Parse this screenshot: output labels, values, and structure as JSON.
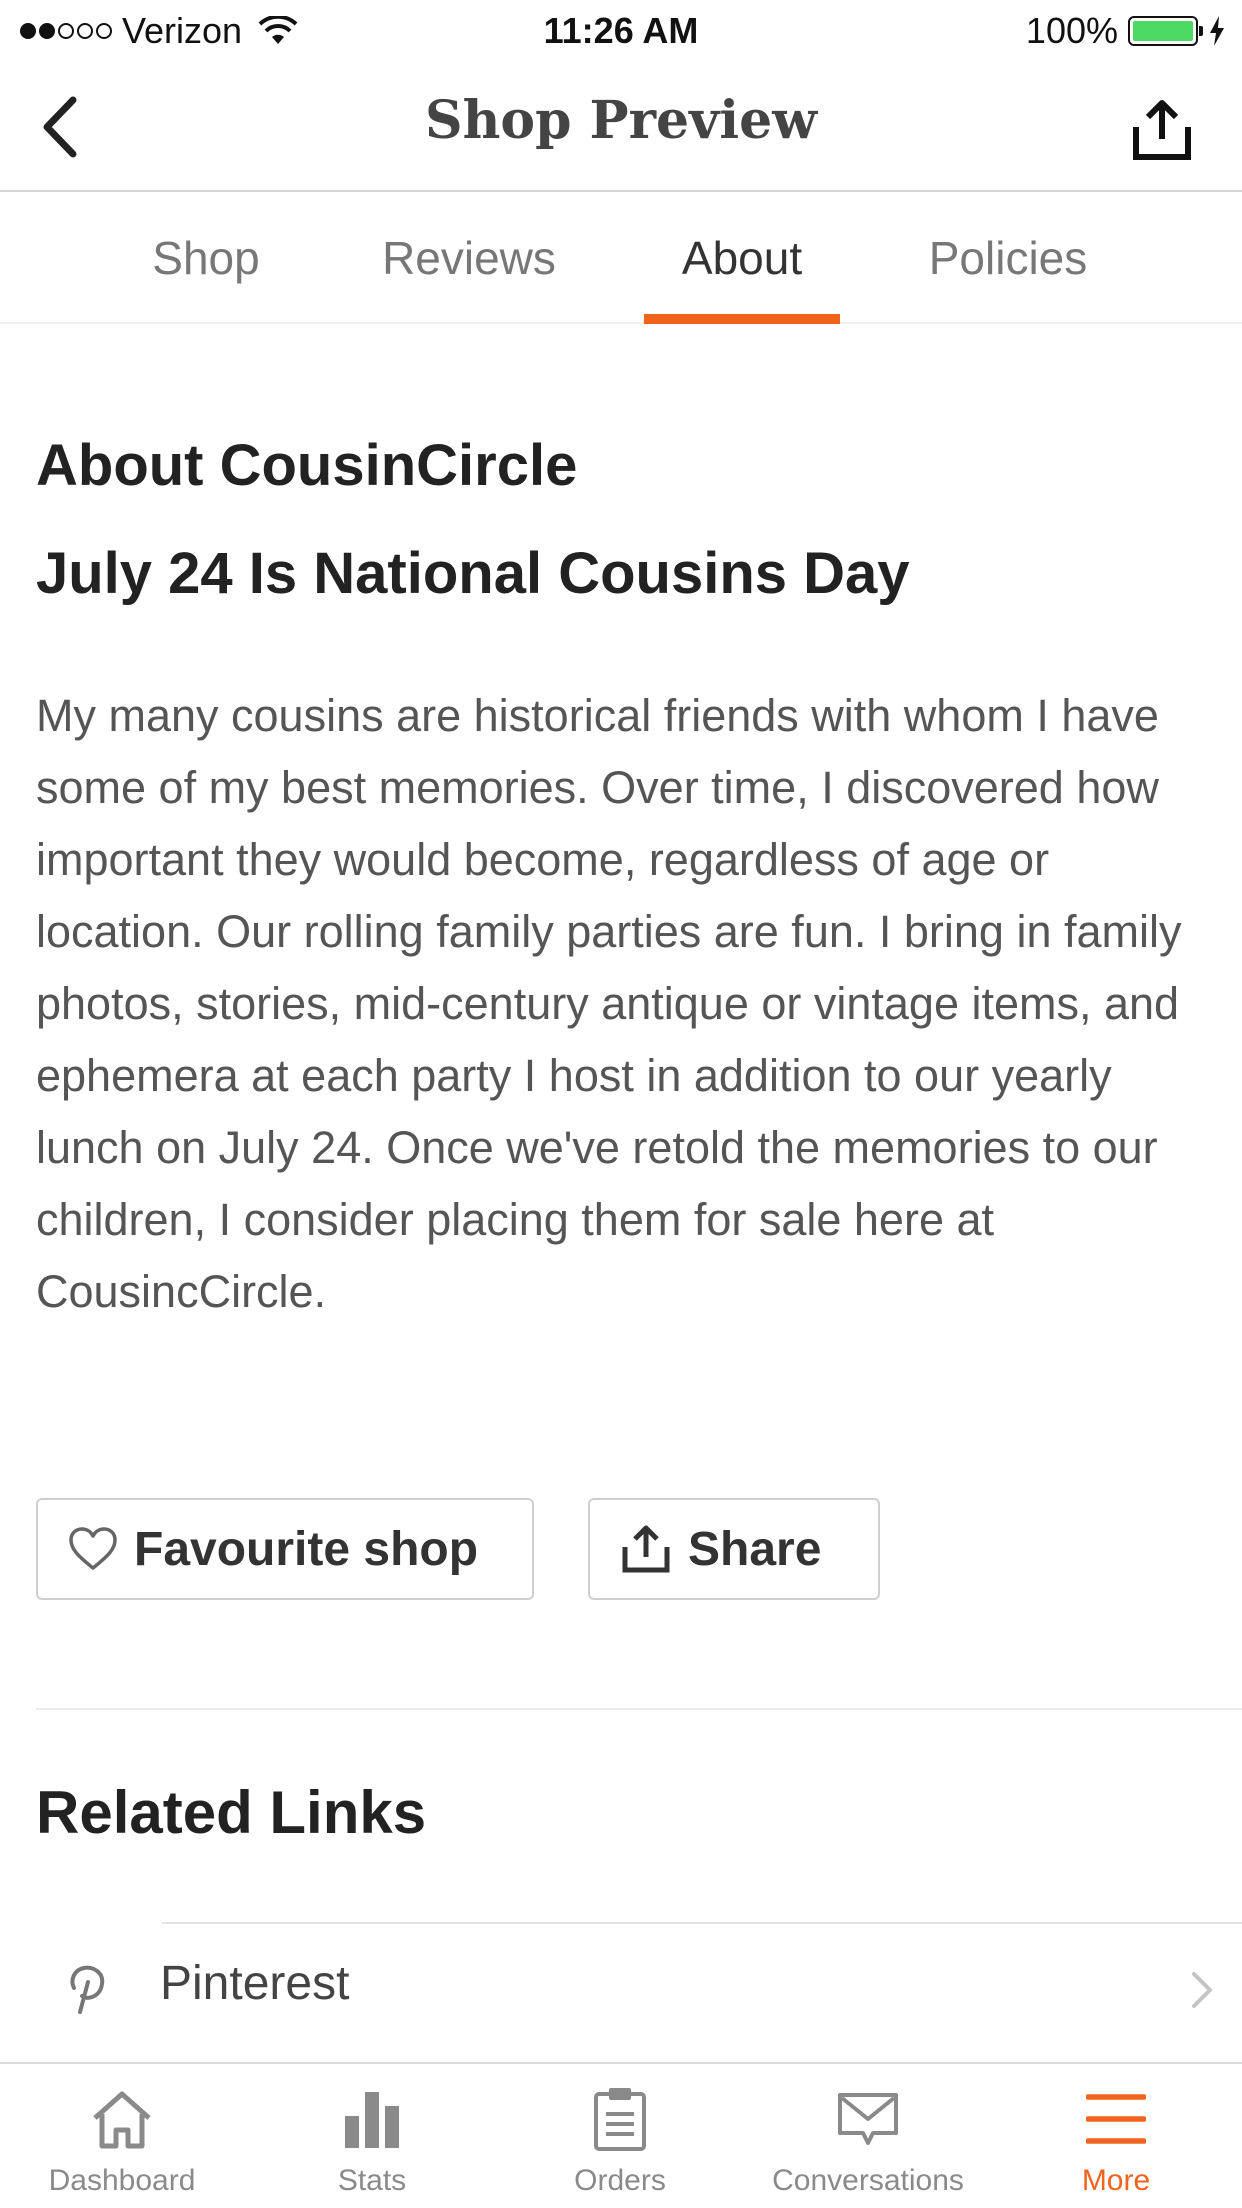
{
  "status_bar": {
    "carrier": "Verizon",
    "time": "11:26 AM",
    "battery": "100%"
  },
  "nav": {
    "title": "Shop Preview",
    "back_icon": "chevron-left-icon",
    "share_icon": "share-icon"
  },
  "tabs": [
    {
      "label": "Shop",
      "active": false
    },
    {
      "label": "Reviews",
      "active": false
    },
    {
      "label": "About",
      "active": true
    },
    {
      "label": "Policies",
      "active": false
    }
  ],
  "about": {
    "title": "About CousinCircle",
    "headline": "July 24 Is National Cousins Day",
    "story": "My many cousins are historical friends with whom I have some of my best memories. Over time, I discovered how important they would become, regardless of age or location. Our rolling family parties are fun. I bring in family photos, stories, mid-century antique or vintage items, and ephemera at each party I host in addition to our yearly lunch on July 24. Once we've retold the memories to our children, I consider placing them for sale here at CousincCircle."
  },
  "actions": {
    "favourite_label": "Favourite shop",
    "share_label": "Share"
  },
  "related": {
    "title": "Related Links",
    "links": [
      {
        "label": "Pinterest",
        "icon": "pinterest-icon"
      }
    ]
  },
  "tab_bar": [
    {
      "label": "Dashboard",
      "icon": "home-icon",
      "active": false
    },
    {
      "label": "Stats",
      "icon": "bar-chart-icon",
      "active": false
    },
    {
      "label": "Orders",
      "icon": "clipboard-icon",
      "active": false
    },
    {
      "label": "Conversations",
      "icon": "mail-icon",
      "active": false
    },
    {
      "label": "More",
      "icon": "menu-icon",
      "active": true
    }
  ],
  "colors": {
    "accent": "#f1641e",
    "battery": "#4cd964"
  }
}
